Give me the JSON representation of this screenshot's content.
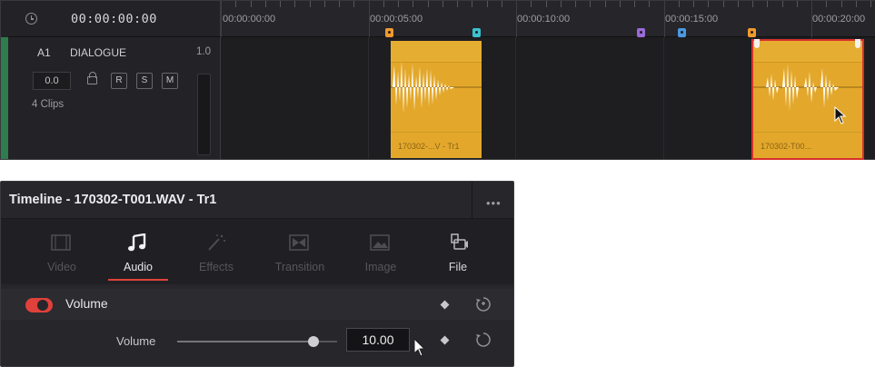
{
  "timeline": {
    "timecode": "00:00:00:00",
    "ruler_labels": [
      "00:00:00:00",
      "00:00:05:00",
      "00:00:10:00",
      "00:00:15:00",
      "00:00:20:00"
    ],
    "track": {
      "id": "A1",
      "name": "DIALOGUE",
      "channels": "1.0",
      "volume": "0.0",
      "buttons": [
        "R",
        "S",
        "M"
      ],
      "clip_count": "4 Clips"
    },
    "clips": [
      {
        "name": "170302-...V - Tr1",
        "color": "#e3a82b",
        "selected": false
      },
      {
        "name": "170302-T00...",
        "color": "#e3a82b",
        "selected": true
      }
    ],
    "markers": [
      {
        "color": "#f09a2c"
      },
      {
        "color": "#3bc2cf"
      },
      {
        "color": "#9a6ad8"
      },
      {
        "color": "#4a98e0"
      },
      {
        "color": "#f09a2c"
      }
    ]
  },
  "inspector": {
    "title": "Timeline - 170302-T001.WAV - Tr1",
    "more_label": "•••",
    "tabs": [
      {
        "label": "Video",
        "icon": "film-icon",
        "active": false
      },
      {
        "label": "Audio",
        "icon": "music-note-icon",
        "active": true
      },
      {
        "label": "Effects",
        "icon": "magic-wand-icon",
        "active": false
      },
      {
        "label": "Transition",
        "icon": "transition-icon",
        "active": false
      },
      {
        "label": "Image",
        "icon": "image-icon",
        "active": false
      },
      {
        "label": "File",
        "icon": "file-icon",
        "active": false
      }
    ],
    "section_title": "Volume",
    "slider_label": "Volume",
    "volume_value": "10.00",
    "accent_color": "#e0413a"
  }
}
